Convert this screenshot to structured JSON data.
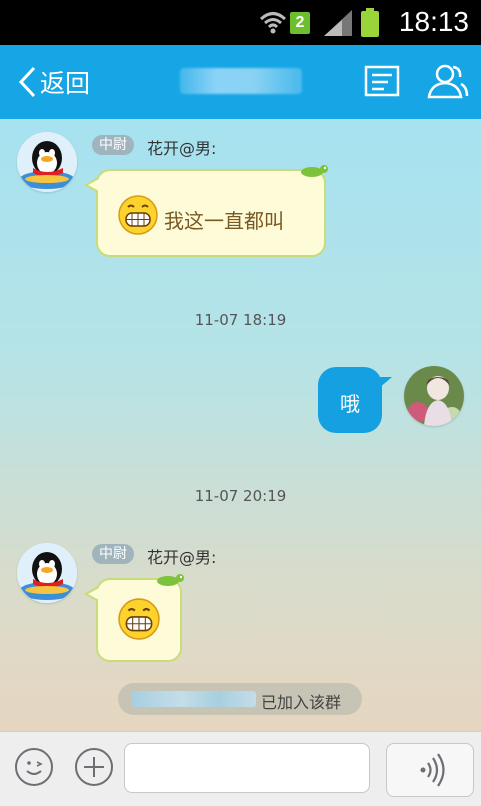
{
  "status_bar": {
    "time": "18:13",
    "sim_badge": "2",
    "icons": [
      "wifi-icon",
      "signal-icon",
      "battery-icon"
    ]
  },
  "header": {
    "back_label": "返回",
    "title": "",
    "icons": [
      "chat-list-icon",
      "group-members-icon"
    ],
    "color": "#16a6e6"
  },
  "messages": [
    {
      "direction": "incoming",
      "rank": "中尉",
      "sender": "花开@男:",
      "text": "我这一直都叫",
      "has_emoji": true
    },
    {
      "type": "timestamp",
      "text": "11-07 18:19"
    },
    {
      "direction": "outgoing",
      "text": "哦"
    },
    {
      "type": "timestamp",
      "text": "11-07 20:19"
    },
    {
      "direction": "incoming",
      "rank": "中尉",
      "sender": "花开@男:",
      "text": "",
      "has_emoji": true
    },
    {
      "type": "system_notice",
      "text": "已加入该群"
    }
  ],
  "input_bar": {
    "input_value": "",
    "icons": [
      "emoji-icon",
      "plus-icon",
      "voice-icon"
    ]
  },
  "colors": {
    "accent": "#16a6e6",
    "outgoing_bubble": "#14a0e1",
    "incoming_bubble": "#fefbd9"
  }
}
